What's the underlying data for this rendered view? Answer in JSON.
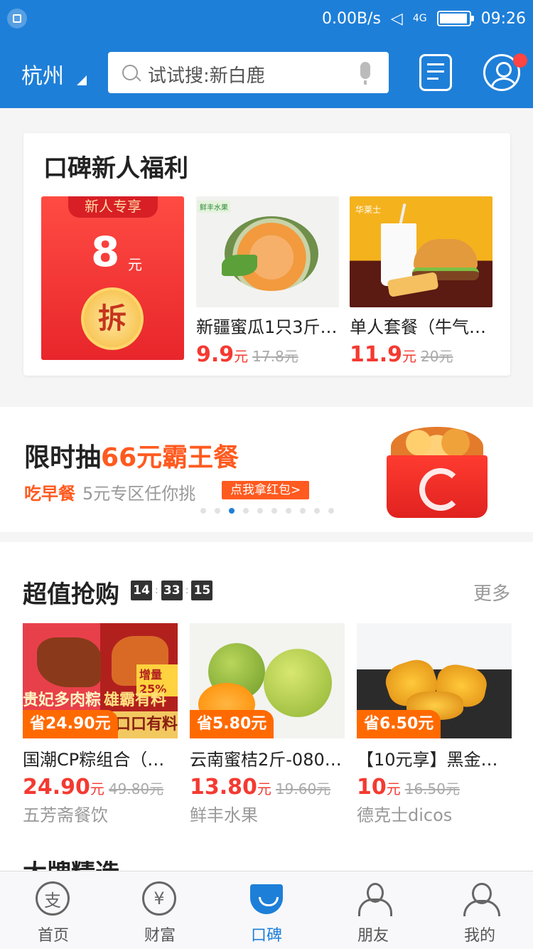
{
  "status_bar": {
    "net_speed": "0.00B/s",
    "network": "4G",
    "time": "09:26"
  },
  "header": {
    "city": "杭州",
    "search_placeholder": "试试搜:新白鹿"
  },
  "welfare": {
    "title": "口碑新人福利",
    "red_packet": {
      "tag": "新人专享",
      "amount": "8",
      "unit": "元",
      "action": "拆"
    },
    "products": [
      {
        "name": "新疆蜜瓜1只3斤…",
        "price": "9.9",
        "unit": "元",
        "old_price": "17.8元"
      },
      {
        "name": "单人套餐（牛气…",
        "price": "11.9",
        "unit": "元",
        "old_price": "20元"
      }
    ]
  },
  "banner": {
    "title_prefix": "限时抽",
    "title_highlight": "66元霸王餐",
    "sub_highlight": "吃早餐",
    "sub_text": "5元专区任你挑",
    "button": "点我拿红包>",
    "page_count": 10,
    "active_page": 3
  },
  "deals": {
    "title": "超值抢购",
    "timer": [
      "14",
      "33",
      "15"
    ],
    "more": "更多",
    "items": [
      {
        "save": "省24.90元",
        "name": "国潮CP粽组合（…",
        "price": "24.90",
        "unit": "元",
        "old_price": "49.80元",
        "shop": "五芳斋餐饮",
        "img_text1": "贵妃多肉粽",
        "img_text2": "雄霸有料粽",
        "img_tag": "增量25%",
        "img_strip": "口口有料"
      },
      {
        "save": "省5.80元",
        "name": "云南蜜桔2斤-080…",
        "price": "13.80",
        "unit": "元",
        "old_price": "19.60元",
        "shop": "鲜丰水果"
      },
      {
        "save": "省6.50元",
        "name": "【10元享】黑金…",
        "price": "10",
        "unit": "元",
        "old_price": "16.50元",
        "shop": "德克士dicos"
      }
    ]
  },
  "next_section": "大牌精选",
  "tabbar": [
    {
      "label": "首页",
      "glyph": "支"
    },
    {
      "label": "财富",
      "glyph": "¥"
    },
    {
      "label": "口碑"
    },
    {
      "label": "朋友"
    },
    {
      "label": "我的"
    }
  ],
  "colors": {
    "brand": "#1e7fd8",
    "price": "#f43a31",
    "accent": "#ff5a1f"
  }
}
